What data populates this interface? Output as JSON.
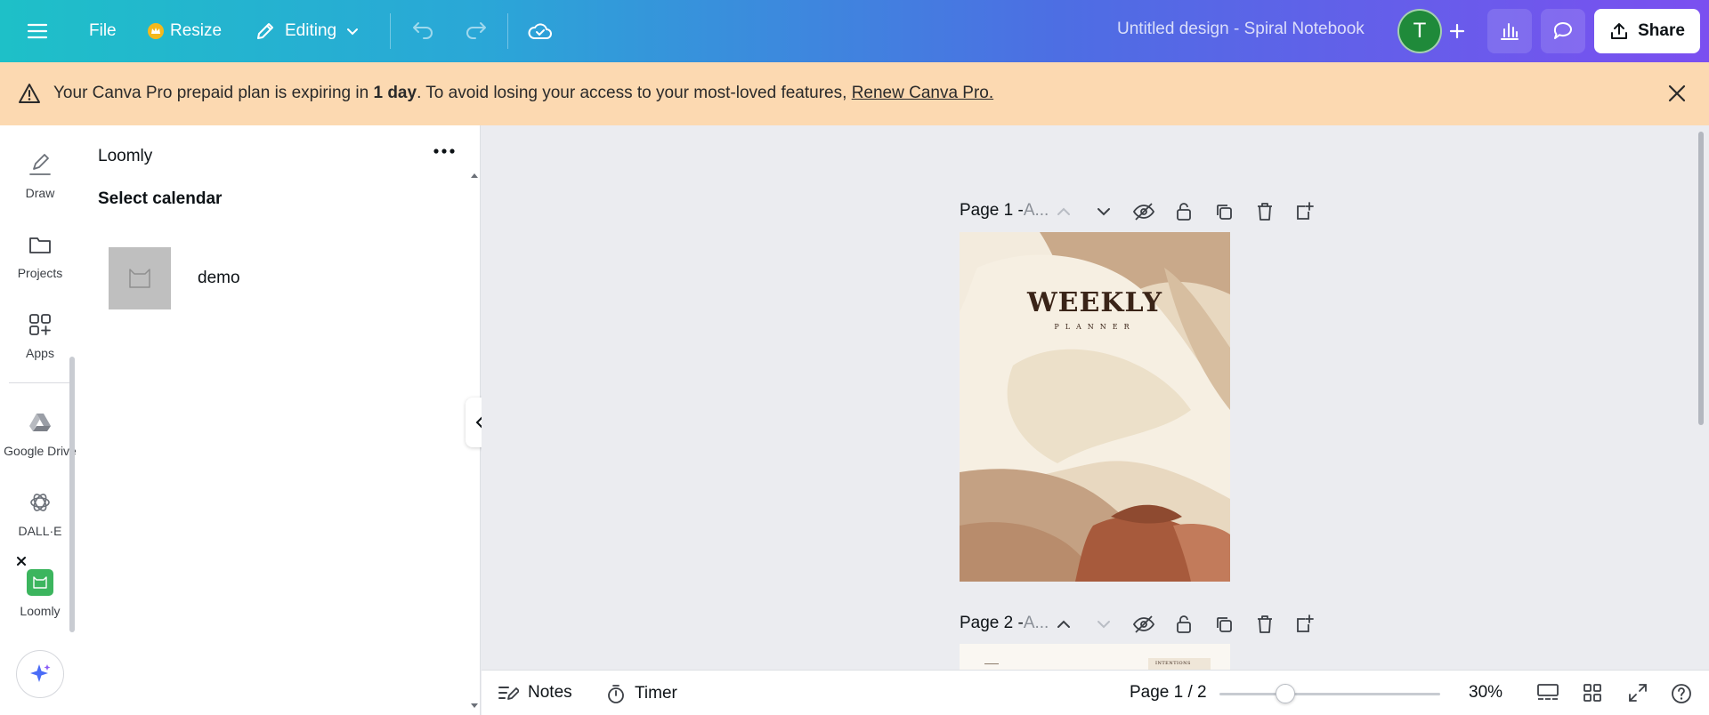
{
  "topbar": {
    "file_label": "File",
    "resize_label": "Resize",
    "editing_label": "Editing",
    "doc_title": "Untitled design - Spiral Notebook",
    "avatar_letter": "T",
    "share_label": "Share",
    "colors": {
      "gradient_start": "#1ec0c8",
      "gradient_end": "#7b4ff0",
      "avatar": "#1f8a3a",
      "crown": "#f5b81c"
    }
  },
  "banner": {
    "text_before": "Your Canva Pro prepaid plan is expiring in ",
    "text_bold": "1 day",
    "text_after": ". To avoid losing your access to your most-loved features, ",
    "link_text": "Renew Canva Pro.",
    "color": "#fcd9b1"
  },
  "rail": {
    "items": [
      {
        "label": "Draw",
        "icon": "draw-icon"
      },
      {
        "label": "Projects",
        "icon": "folder-icon"
      },
      {
        "label": "Apps",
        "icon": "apps-icon"
      },
      {
        "label": "Google Drive",
        "icon": "google-drive-icon"
      },
      {
        "label": "DALL·E",
        "icon": "dalle-icon"
      },
      {
        "label": "Loomly",
        "icon": "loomly-icon"
      }
    ]
  },
  "panel": {
    "title": "Loomly",
    "subtitle": "Select calendar",
    "calendars": [
      {
        "name": "demo"
      }
    ]
  },
  "pages": [
    {
      "label": "Page 1 - ",
      "suffix": "A..."
    },
    {
      "label": "Page 2 - ",
      "suffix": "A..."
    }
  ],
  "design": {
    "title": "WEEKLY",
    "subtitle": "PLANNER",
    "page2_text": "INTENTIONS"
  },
  "bottombar": {
    "notes_label": "Notes",
    "timer_label": "Timer",
    "page_indicator": "Page 1 / 2",
    "zoom_label": "30%",
    "zoom_fraction": 0.3
  }
}
